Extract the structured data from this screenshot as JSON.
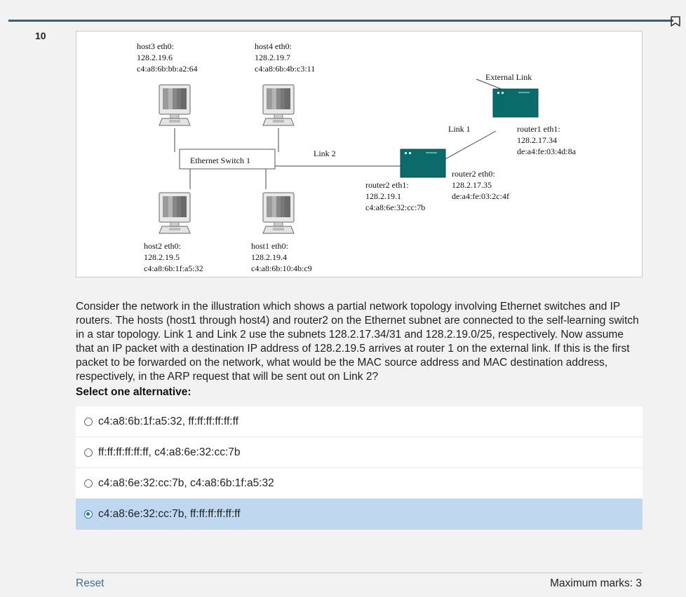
{
  "question": {
    "number": "10",
    "text": "Consider the network in the illustration which shows a partial network topology involving Ethernet switches and IP routers. The hosts (host1 through host4) and router2 on the Ethernet subnet are connected to the self-learning switch in a star topology. Link 1 and Link 2 use the subnets 128.2.17.34/31 and 128.2.19.0/25, respectively. Now assume that an IP packet with a destination IP address of 128.2.19.5 arrives at router 1 on the external link. If this is the first packet to be forwarded on the network, what would be the MAC source address and MAC destination address, respectively, in the ARP request that will be sent out on Link 2?",
    "select_label": "Select one alternative:",
    "options": [
      {
        "label": "c4:a8:6b:1f:a5:32, ff:ff:ff:ff:ff:ff",
        "selected": false
      },
      {
        "label": "ff:ff:ff:ff:ff:ff, c4:a8:6e:32:cc:7b",
        "selected": false
      },
      {
        "label": "c4:a8:6e:32:cc:7b, c4:a8:6b:1f:a5:32",
        "selected": false
      },
      {
        "label": "c4:a8:6e:32:cc:7b, ff:ff:ff:ff:ff:ff",
        "selected": true
      }
    ]
  },
  "footer": {
    "reset_label": "Reset",
    "marks_label": "Maximum marks: 3"
  },
  "diagram": {
    "host3": {
      "iface": "host3 eth0:",
      "ip": "128.2.19.6",
      "mac": "c4:a8:6b:bb:a2:64"
    },
    "host4": {
      "iface": "host4 eth0:",
      "ip": "128.2.19.7",
      "mac": "c4:a8:6b:4b:c3:11"
    },
    "host2": {
      "iface": "host2 eth0:",
      "ip": "128.2.19.5",
      "mac": "c4:a8:6b:1f:a5:32"
    },
    "host1": {
      "iface": "host1 eth0:",
      "ip": "128.2.19.4",
      "mac": "c4:a8:6b:10:4b:c9"
    },
    "switch_label": "Ethernet Switch 1",
    "link2_label": "Link 2",
    "link1_label": "Link 1",
    "external_link_label": "External Link",
    "router2_eth1": {
      "iface": "router2 eth1:",
      "ip": "128.2.19.1",
      "mac": "c4:a8:6e:32:cc:7b"
    },
    "router2_eth0": {
      "iface": "router2 eth0:",
      "ip": "128.2.17.35",
      "mac": "de:a4:fe:03:2c:4f"
    },
    "router1_eth1": {
      "iface": "router1 eth1:",
      "ip": "128.2.17.34",
      "mac": "de:a4:fe:03:4d:8a"
    }
  },
  "colors": {
    "router": "#0b6a6a",
    "selected_bg": "#bfd8f0",
    "accent": "#1a6fd1",
    "topbar": "#4a5a6e"
  },
  "icons": {
    "flag": "flag-icon",
    "computer": "computer-icon",
    "router": "router-icon"
  }
}
